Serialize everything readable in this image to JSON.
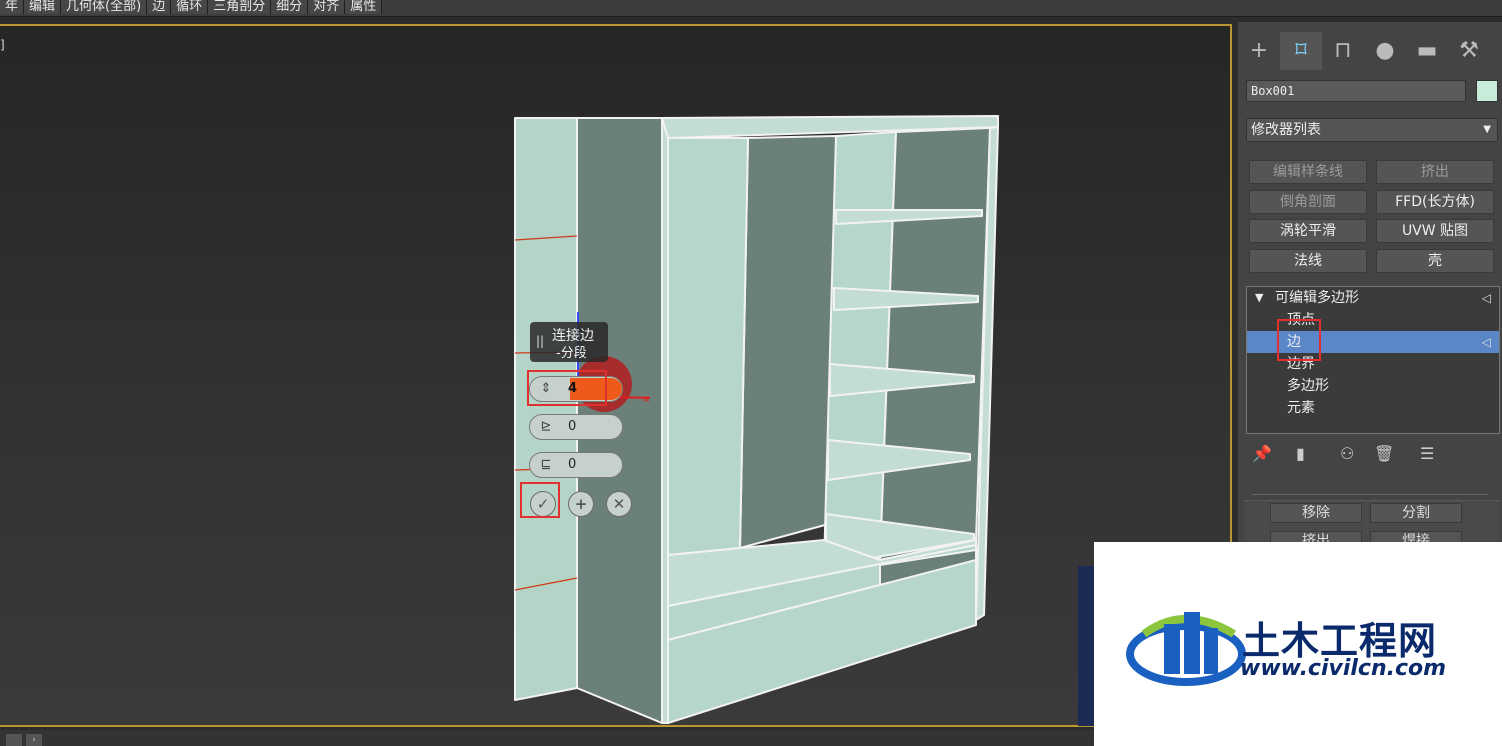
{
  "menubar": {
    "items": [
      "年",
      "编辑",
      "几何体(全部)",
      "边",
      "循环",
      "三角剖分",
      "细分",
      "对齐",
      "属性"
    ]
  },
  "viewport": {
    "label": "]"
  },
  "caddy": {
    "title_line1": "连接边",
    "title_line2": "-分段",
    "grip": "||",
    "segments_value": "4",
    "pinch_value": "0",
    "slide_value": "0"
  },
  "panel": {
    "object_name": "Box001",
    "object_color": "#c8ecd9",
    "modifier_list": "修改器列表",
    "modifier_buttons": [
      "编辑样条线",
      "挤出",
      "倒角剖面",
      "FFD(长方体)",
      "涡轮平滑",
      "UVW 贴图",
      "法线",
      "壳"
    ],
    "stack": {
      "root": "可编辑多边形",
      "subobjects": [
        "顶点",
        "边",
        "边界",
        "多边形",
        "元素"
      ],
      "selected": "边"
    },
    "edge_buttons": [
      "移除",
      "分割",
      "挤出",
      "焊接"
    ]
  },
  "watermark": {
    "title": "土木工程网",
    "url": "www.civilcn.com"
  },
  "colors": {
    "viewport_border": "#b8972e",
    "selection": "#5b87c9",
    "highlight": "#e03030",
    "model": "#b5d6c8"
  }
}
